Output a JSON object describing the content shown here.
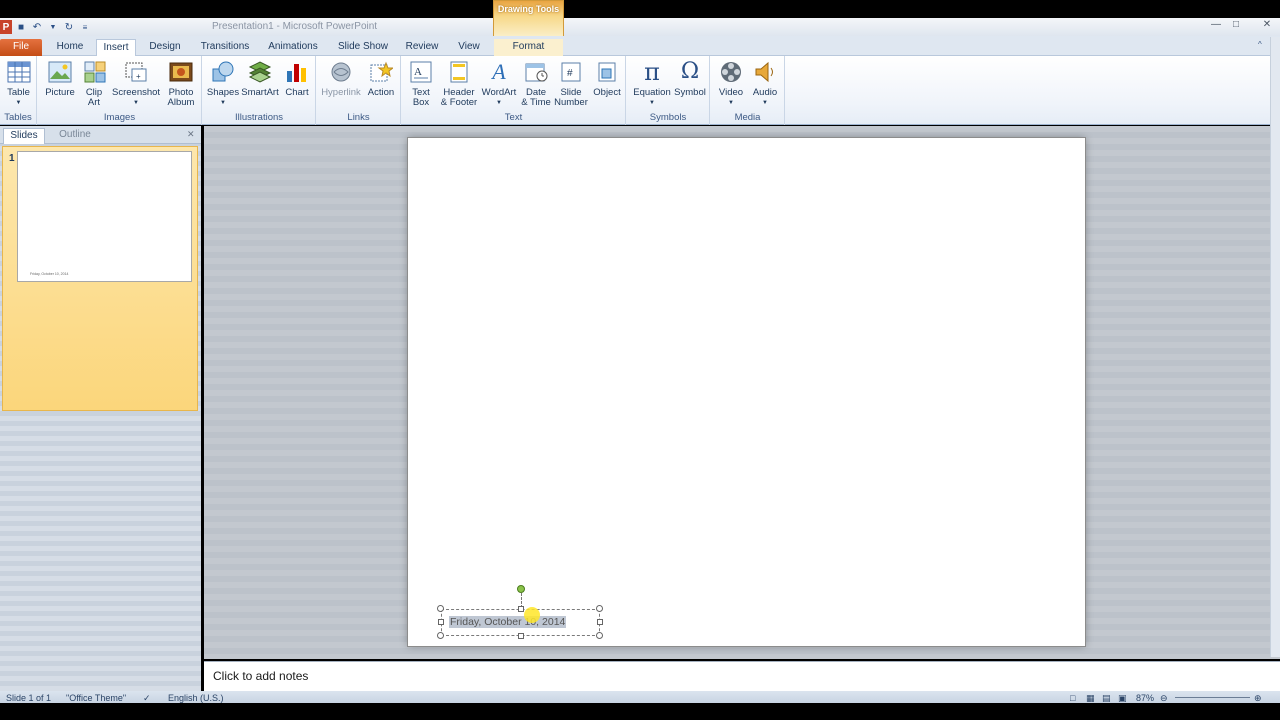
{
  "window": {
    "title": "Presentation1 - Microsoft PowerPoint",
    "contextual_group": "Drawing Tools"
  },
  "tabs": [
    {
      "label": "File"
    },
    {
      "label": "Home"
    },
    {
      "label": "Insert"
    },
    {
      "label": "Design"
    },
    {
      "label": "Transitions"
    },
    {
      "label": "Animations"
    },
    {
      "label": "Slide Show"
    },
    {
      "label": "Review"
    },
    {
      "label": "View"
    },
    {
      "label": "Format"
    }
  ],
  "active_tab": "Insert",
  "ribbon": {
    "groups": {
      "tables": {
        "label": "Tables",
        "commands": [
          {
            "label": "Table",
            "icon": "table-icon"
          }
        ]
      },
      "images": {
        "label": "Images",
        "commands": [
          {
            "label": "Picture",
            "icon": "picture-icon"
          },
          {
            "label": "Clip Art",
            "icon": "clip-art-icon"
          },
          {
            "label": "Screenshot",
            "icon": "screenshot-icon"
          },
          {
            "label": "Photo Album",
            "icon": "photo-album-icon"
          }
        ]
      },
      "illustrations": {
        "label": "Illustrations",
        "commands": [
          {
            "label": "Shapes",
            "icon": "shapes-icon"
          },
          {
            "label": "SmartArt",
            "icon": "smartart-icon"
          },
          {
            "label": "Chart",
            "icon": "chart-icon"
          }
        ]
      },
      "links": {
        "label": "Links",
        "commands": [
          {
            "label": "Hyperlink",
            "icon": "hyperlink-icon"
          },
          {
            "label": "Action",
            "icon": "action-icon"
          }
        ]
      },
      "text": {
        "label": "Text",
        "commands": [
          {
            "label": "Text Box",
            "icon": "text-box-icon"
          },
          {
            "label": "Header & Footer",
            "icon": "header-footer-icon"
          },
          {
            "label": "WordArt",
            "icon": "wordart-icon"
          },
          {
            "label": "Date & Time",
            "icon": "date-time-icon"
          },
          {
            "label": "Slide Number",
            "icon": "slide-number-icon"
          },
          {
            "label": "Object",
            "icon": "object-icon"
          }
        ]
      },
      "symbols": {
        "label": "Symbols",
        "commands": [
          {
            "label": "Equation",
            "icon": "equation-icon"
          },
          {
            "label": "Symbol",
            "icon": "symbol-icon"
          }
        ]
      },
      "media": {
        "label": "Media",
        "commands": [
          {
            "label": "Video",
            "icon": "video-icon"
          },
          {
            "label": "Audio",
            "icon": "audio-icon"
          }
        ]
      }
    },
    "text_lines": {
      "clip": [
        "Clip",
        "Art"
      ],
      "photo": [
        "Photo",
        "Album"
      ],
      "textbox": [
        "Text",
        "Box"
      ],
      "header": [
        "Header",
        "& Footer"
      ],
      "date": [
        "Date",
        "& Time"
      ],
      "slidenum": [
        "Slide",
        "Number"
      ]
    }
  },
  "left_pane": {
    "tabs": [
      "Slides",
      "Outline"
    ],
    "slide_number": "1",
    "thumb_text": "Friday, October 10, 2014"
  },
  "slide": {
    "date_text": "Friday, October 10, 2014"
  },
  "notes": {
    "placeholder": "Click to add notes"
  },
  "status": {
    "slide_info": "Slide 1 of 1",
    "theme": "\"Office Theme\"",
    "language": "English (U.S.)",
    "zoom": "87%"
  }
}
